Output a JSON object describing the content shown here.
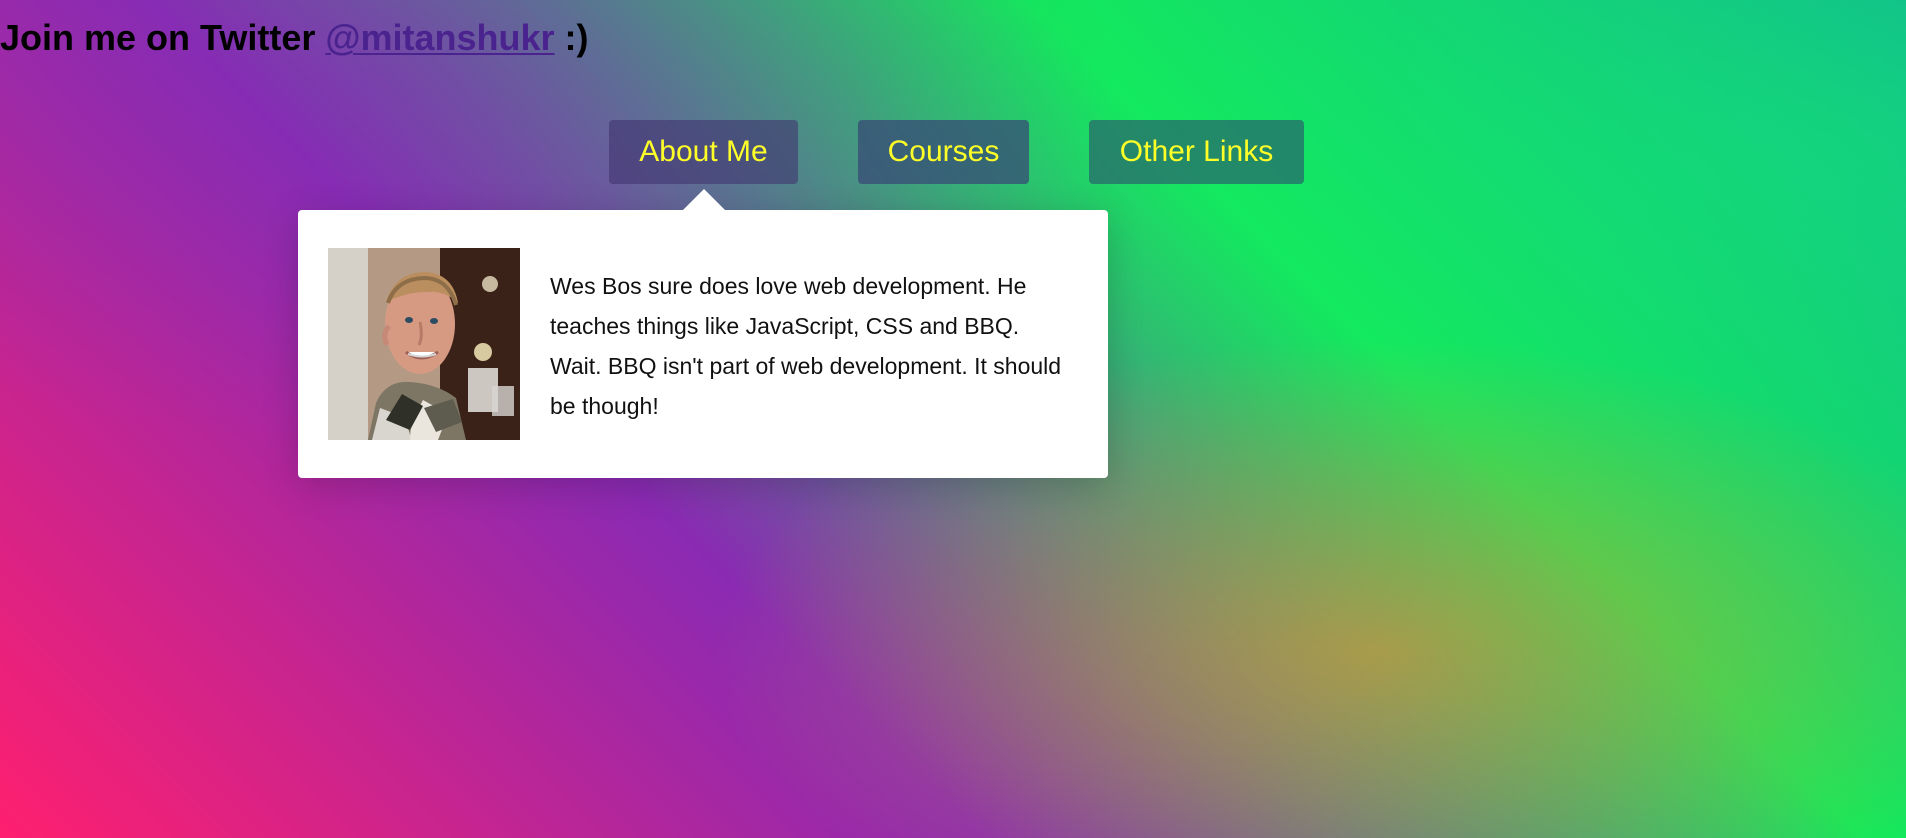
{
  "header": {
    "prefix": "Join me on Twitter ",
    "handle": "@mitanshukr",
    "suffix": " :)"
  },
  "nav": {
    "items": [
      {
        "label": "About Me",
        "active": true
      },
      {
        "label": "Courses",
        "active": false
      },
      {
        "label": "Other Links",
        "active": false
      }
    ]
  },
  "popover": {
    "bio": "Wes Bos sure does love web development. He teaches things like JavaScript, CSS and BBQ. Wait. BBQ isn't part of web development. It should be though!"
  },
  "colors": {
    "nav_text": "#ffff28",
    "handle": "#4b238f",
    "popover_bg": "#ffffff"
  },
  "icons": {
    "avatar": "profile-photo"
  }
}
